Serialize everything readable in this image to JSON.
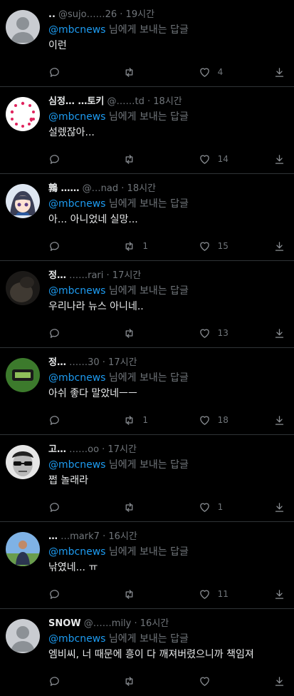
{
  "tweets": [
    {
      "name": "..",
      "handle": "@sujo……26",
      "time": "· 19시간",
      "reply_prefix": "@mbcnews",
      "reply_suffix": " 님에게 보내는 답글",
      "text": "이런",
      "replies": "",
      "retweets": "",
      "likes": "4",
      "avatar": "default"
    },
    {
      "name": "심정… …토키",
      "handle": "@……td",
      "time": "· 18시간",
      "reply_prefix": "@mbcnews",
      "reply_suffix": " 님에게 보내는 답글",
      "text": "설렜잖아...",
      "replies": "",
      "retweets": "",
      "likes": "14",
      "avatar": "hearts"
    },
    {
      "name": "鶉 ……",
      "handle": "@…nad",
      "time": "· 18시간",
      "reply_prefix": "@mbcnews",
      "reply_suffix": " 님에게 보내는 답글",
      "text": "아... 아니었네 실망...",
      "replies": "",
      "retweets": "1",
      "likes": "15",
      "avatar": "anime"
    },
    {
      "name": "정…",
      "handle": "……rari",
      "time": "· 17시간",
      "reply_prefix": "@mbcnews",
      "reply_suffix": " 님에게 보내는 답글",
      "text": "우리나라 뉴스 아니네..",
      "replies": "",
      "retweets": "",
      "likes": "13",
      "avatar": "dark"
    },
    {
      "name": "정…",
      "handle": "……30",
      "time": "· 17시간",
      "reply_prefix": "@mbcnews",
      "reply_suffix": " 님에게 보내는 답글",
      "text": "아쉬 좋다 말았네ㅡㅡ",
      "replies": "",
      "retweets": "1",
      "likes": "18",
      "avatar": "green"
    },
    {
      "name": "고…",
      "handle": "……oo",
      "time": "· 17시간",
      "reply_prefix": "@mbcnews",
      "reply_suffix": " 님에게 보내는 답글",
      "text": "쩝 놀래라",
      "replies": "",
      "retweets": "",
      "likes": "1",
      "avatar": "sunglasses"
    },
    {
      "name": "…",
      "handle": "…mark7",
      "time": "· 16시간",
      "reply_prefix": "@mbcnews",
      "reply_suffix": " 님에게 보내는 답글",
      "text": "낚였네... ㅠ",
      "replies": "",
      "retweets": "",
      "likes": "11",
      "avatar": "person"
    },
    {
      "name": "SNOW",
      "handle": "@……mily",
      "time": "· 16시간",
      "reply_prefix": "@mbcnews",
      "reply_suffix": " 님에게 보내는 답글",
      "text": "엠비씨, 너 때문에 흥이 다 깨져버렸으니까 책임져",
      "replies": "",
      "retweets": "",
      "likes": "",
      "avatar": "default"
    }
  ]
}
